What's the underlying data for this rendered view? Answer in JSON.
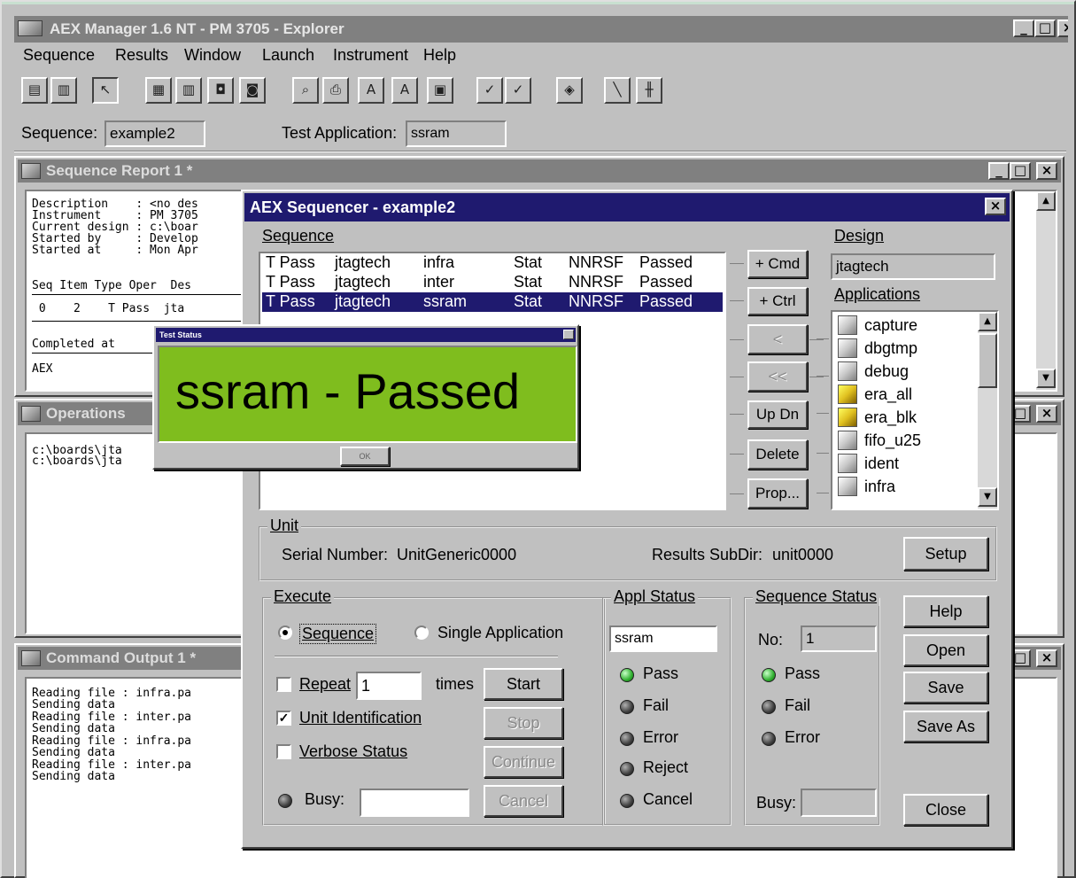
{
  "main_window": {
    "title": "AEX Manager 1.6 NT - PM 3705 - Explorer",
    "menu": [
      "Sequence",
      "Results",
      "Window",
      "Launch",
      "Instrument",
      "Help"
    ],
    "sequence_label": "Sequence:",
    "sequence_value": "example2",
    "test_app_label": "Test Application:",
    "test_app_value": "ssram"
  },
  "report_window": {
    "title": "Sequence Report 1 *",
    "lines": [
      "Description    : <no des",
      "Instrument     : PM 3705",
      "Current design : c:\\boar",
      "Started by     : Develop",
      "Started at     : Mon Apr"
    ],
    "table_header": "Seq Item Type Oper  Des",
    "table_row": " 0    2    T Pass  jta",
    "completed": "Completed at",
    "footer": "AEX"
  },
  "operations_window": {
    "title": "Operations",
    "lines": [
      "c:\\boards\\jta",
      "c:\\boards\\jta"
    ]
  },
  "command_window": {
    "title": "Command Output 1 *",
    "lines": [
      "Reading file : infra.pa",
      "Sending data",
      "Reading file : inter.pa",
      "Sending data",
      "Reading file : infra.pa",
      "Sending data",
      "Reading file : inter.pa",
      "Sending data"
    ]
  },
  "sequencer": {
    "title": "AEX Sequencer - example2",
    "sequence_label": "Sequence",
    "rows": [
      {
        "type": "T Pass",
        "name": "jtagtech",
        "app": "infra",
        "mode": "Stat",
        "flags": "NNRSF",
        "result": "Passed"
      },
      {
        "type": "T Pass",
        "name": "jtagtech",
        "app": "inter",
        "mode": "Stat",
        "flags": "NNRSF",
        "result": "Passed"
      },
      {
        "type": "T Pass",
        "name": "jtagtech",
        "app": "ssram",
        "mode": "Stat",
        "flags": "NNRSF",
        "result": "Passed"
      }
    ],
    "buttons": {
      "cmd": "+ Cmd",
      "ctrl": "+ Ctrl",
      "left": "<",
      "left2": "<<",
      "updn": "Up Dn",
      "delete": "Delete",
      "prop": "Prop..."
    },
    "design_label": "Design",
    "design_value": "jtagtech",
    "applications_label": "Applications",
    "applications": [
      "capture",
      "dbgtmp",
      "debug",
      "era_all",
      "era_blk",
      "fifo_u25",
      "ident",
      "infra"
    ],
    "unit": {
      "title": "Unit",
      "serial_label": "Serial Number:",
      "serial_value": "UnitGeneric0000",
      "subdir_label": "Results SubDir:",
      "subdir_value": "unit0000",
      "setup": "Setup"
    },
    "execute": {
      "title": "Execute",
      "radio_sequence": "Sequence",
      "radio_single": "Single Application",
      "repeat_label": "Repeat",
      "repeat_value": "1",
      "times": "times",
      "unit_ident": "Unit Identification",
      "verbose": "Verbose Status",
      "busy": "Busy:",
      "start": "Start",
      "stop": "Stop",
      "continue": "Continue",
      "cancel": "Cancel"
    },
    "appl_status": {
      "title": "Appl Status",
      "value": "ssram",
      "items": [
        "Pass",
        "Fail",
        "Error",
        "Reject",
        "Cancel"
      ]
    },
    "seq_status": {
      "title": "Sequence Status",
      "no_label": "No:",
      "no_value": "1",
      "items": [
        "Pass",
        "Fail",
        "Error"
      ],
      "busy": "Busy:"
    },
    "side_buttons": [
      "Help",
      "Open",
      "Save",
      "Save As",
      "Close"
    ]
  },
  "status_popup": {
    "title": "Test Status",
    "message": "ssram - Passed",
    "ok": "OK",
    "color": "#7fbd1e"
  }
}
